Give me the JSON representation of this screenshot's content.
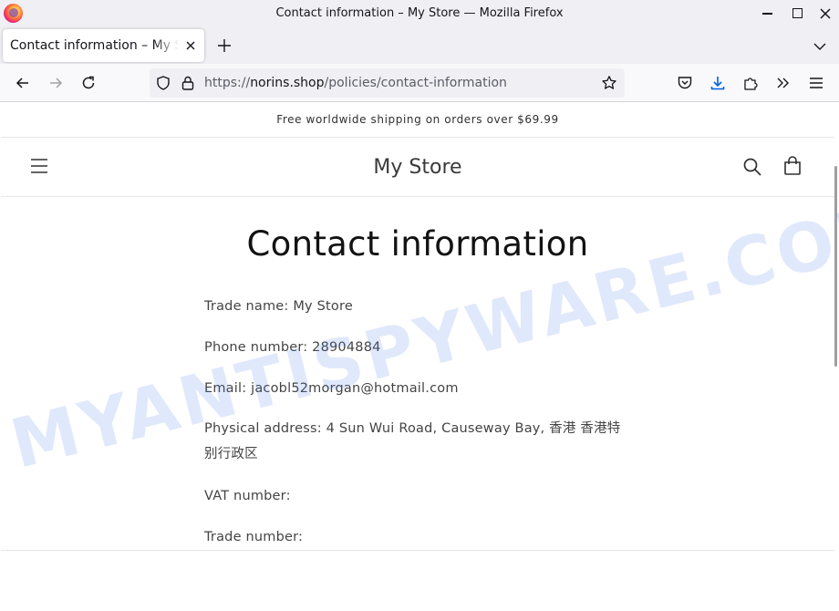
{
  "window": {
    "title": "Contact information – My Store — Mozilla Firefox"
  },
  "tab": {
    "label": "Contact information – My Store"
  },
  "urlbar": {
    "scheme": "https://",
    "domain": "norins.shop",
    "path": "/policies/contact-information"
  },
  "store": {
    "announcement": "Free worldwide shipping on orders over $69.99",
    "name": "My Store"
  },
  "page": {
    "heading": "Contact information",
    "lines": [
      "Trade name: My Store",
      "Phone number: 28904884",
      "Email: jacobl52morgan@hotmail.com",
      "Physical address: 4 Sun Wui Road, Causeway Bay, 香港 香港特别行政区",
      "VAT number:",
      "Trade number:"
    ]
  },
  "watermark": "MYANTISPYWARE.COM",
  "colors": {
    "chrome": "#f0f0f4",
    "accent_download": "#0061e0"
  }
}
